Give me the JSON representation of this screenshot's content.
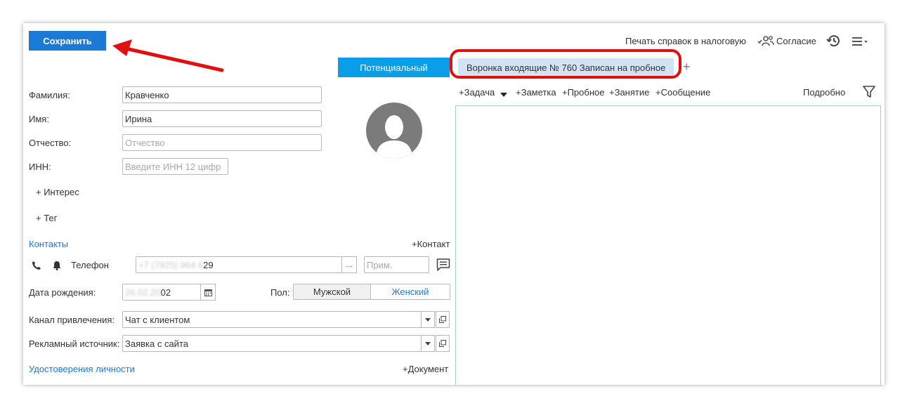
{
  "toolbar": {
    "save_label": "Сохранить",
    "print_tax_label": "Печать справок в налоговую",
    "consent_label": "Согласие"
  },
  "form": {
    "surname_label": "Фамилия:",
    "surname_value": "Кравченко",
    "name_label": "Имя:",
    "name_value": "Ирина",
    "patronymic_label": "Отчество:",
    "patronymic_placeholder": "Отчество",
    "inn_label": "ИНН:",
    "inn_placeholder": "Введите ИНН 12 цифр",
    "interest_label": "+ Интерес",
    "tag_label": "+ Тег"
  },
  "contacts": {
    "title": "Контакты",
    "add_contact": "+Контакт",
    "phone_label": "Телефон",
    "phone_value_hidden": "+7 (7925) 964 6",
    "phone_value_tail": "29",
    "phone_more": "...",
    "note_placeholder": "Прим."
  },
  "birth": {
    "label": "Дата рождения:",
    "value_hidden": "26.02.20",
    "value_tail": "02"
  },
  "gender": {
    "label": "Пол:",
    "male": "Мужской",
    "female": "Женский",
    "selected": "Женский"
  },
  "channel": {
    "label": "Канал привлечения:",
    "value": "Чат с клиентом"
  },
  "ad_source": {
    "label": "Рекламный источник:",
    "value": "Заявка с сайта"
  },
  "identity": {
    "title": "Удостоверения личности",
    "add_document": "+Документ"
  },
  "tabs": {
    "potential": "Потенциальный",
    "funnel": "Воронка входящие № 760  Записан на пробное",
    "add": "+"
  },
  "actions": {
    "task": "+Задача",
    "note": "+Заметка",
    "trial": "+Пробное",
    "lesson": "+Занятие",
    "message": "+Сообщение",
    "details": "Подробно"
  },
  "colors": {
    "primary": "#1a7ad6",
    "tab_active": "#0a9de8",
    "tab_funnel": "#d2e3f3",
    "highlight": "#e01010",
    "timeline_border": "#a6cbe3"
  }
}
